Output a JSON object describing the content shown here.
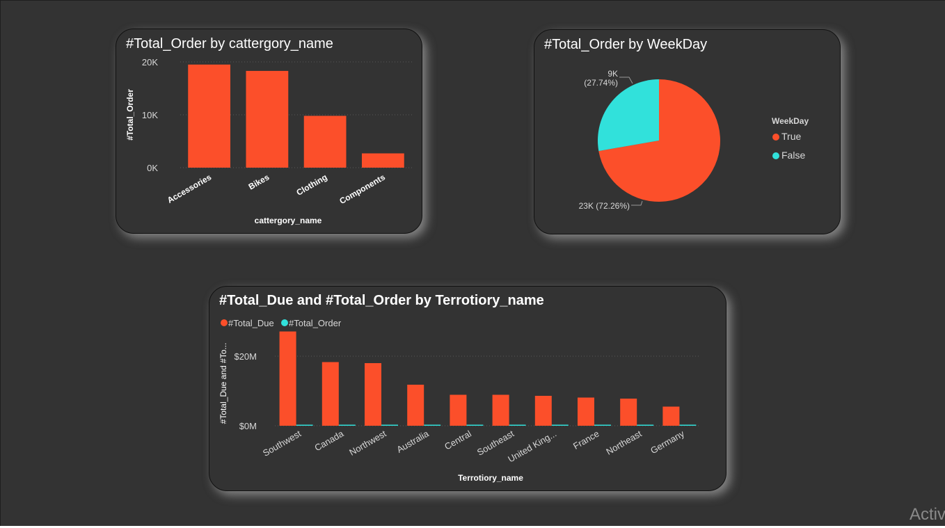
{
  "watermark": "Activ",
  "colors": {
    "true_series": "#FC4F2A",
    "false_series": "#31E1DB",
    "background": "#333333"
  },
  "charts": {
    "category": {
      "title": "#Total_Order by cattergory_name"
    },
    "weekday": {
      "title": "#Total_Order by WeekDay"
    },
    "territory": {
      "title": "#Total_Due and #Total_Order by Terrotiory_name"
    }
  },
  "chart_data": [
    {
      "type": "bar",
      "title": "#Total_Order by cattergory_name",
      "xlabel": "cattergory_name",
      "ylabel": "#Total_Order",
      "categories": [
        "Accessories",
        "Bikes",
        "Clothing",
        "Components"
      ],
      "values": [
        19500,
        18300,
        9800,
        2700
      ],
      "ylim": [
        0,
        20000
      ],
      "yticks": [
        0,
        10000,
        20000
      ],
      "ytick_labels": [
        "0K",
        "10K",
        "20K"
      ],
      "grid": true
    },
    {
      "type": "pie",
      "title": "#Total_Order by WeekDay",
      "legend_title": "WeekDay",
      "legend_position": "right",
      "slices": [
        {
          "label": "True",
          "value": 23000,
          "percent": 72.26,
          "value_text": "23K",
          "percent_text": "(72.26%)",
          "color": "#FC4F2A"
        },
        {
          "label": "False",
          "value": 9000,
          "percent": 27.74,
          "value_text": "9K",
          "percent_text": "(27.74%)",
          "color": "#31E1DB"
        }
      ]
    },
    {
      "type": "bar",
      "title": "#Total_Due and #Total_Order by Terrotiory_name",
      "xlabel": "Terrotiory_name",
      "ylabel": "#Total_Due and #To...",
      "legend_position": "top-left",
      "categories": [
        "Southwest",
        "Canada",
        "Northwest",
        "Australia",
        "Central",
        "Southeast",
        "United King...",
        "France",
        "Northeast",
        "Germany"
      ],
      "series": [
        {
          "name": "#Total_Due",
          "color": "#FC4F2A",
          "values": [
            27100000,
            18300000,
            18000000,
            11800000,
            8900000,
            8900000,
            8600000,
            8100000,
            7800000,
            5500000
          ]
        },
        {
          "name": "#Total_Order",
          "color": "#31E1DB",
          "values": [
            6200,
            4100,
            4600,
            6800,
            400,
            500,
            3200,
            2700,
            100,
            2600
          ]
        }
      ],
      "ylim": [
        0,
        33000000
      ],
      "yticks": [
        0,
        20000000
      ],
      "ytick_labels": [
        "$0M",
        "$20M"
      ],
      "grid": true
    }
  ]
}
